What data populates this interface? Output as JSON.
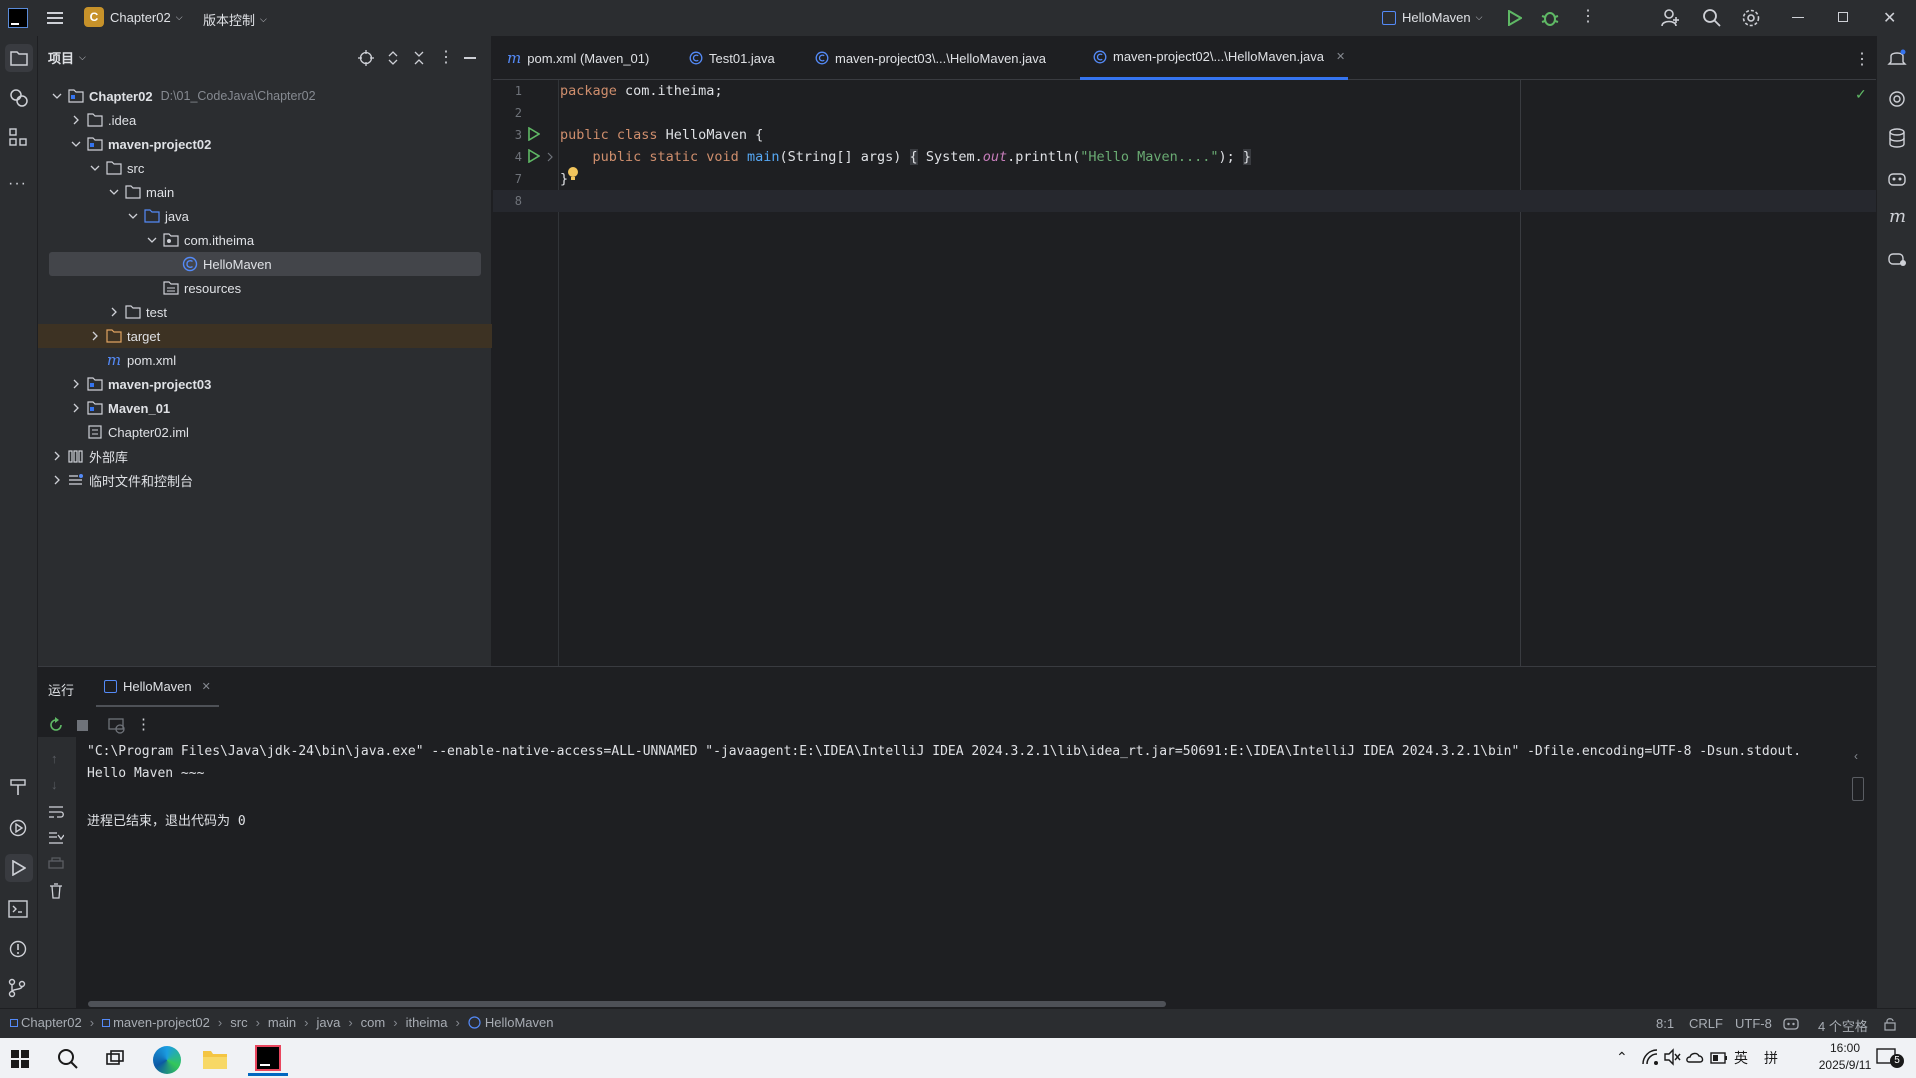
{
  "titlebar": {
    "project_badge": "C",
    "project_name": "Chapter02",
    "vcs_label": "版本控制",
    "run_config": "HelloMaven"
  },
  "project_panel": {
    "title": "项目",
    "tree": [
      {
        "label": "Chapter02",
        "hint": "D:\\01_CodeJava\\Chapter02"
      },
      {
        "label": ".idea"
      },
      {
        "label": "maven-project02"
      },
      {
        "label": "src"
      },
      {
        "label": "main"
      },
      {
        "label": "java"
      },
      {
        "label": "com.itheima"
      },
      {
        "label": "HelloMaven"
      },
      {
        "label": "resources"
      },
      {
        "label": "test"
      },
      {
        "label": "target"
      },
      {
        "label": "pom.xml"
      },
      {
        "label": "maven-project03"
      },
      {
        "label": "Maven_01"
      },
      {
        "label": "Chapter02.iml"
      },
      {
        "label": "外部库"
      },
      {
        "label": "临时文件和控制台"
      }
    ]
  },
  "editor": {
    "tabs": [
      {
        "label": "pom.xml (Maven_01)"
      },
      {
        "label": "Test01.java"
      },
      {
        "label": "maven-project03\\...\\HelloMaven.java"
      },
      {
        "label": "maven-project02\\...\\HelloMaven.java"
      }
    ],
    "line_numbers": [
      "1",
      "2",
      "3",
      "4",
      "7",
      "8"
    ],
    "code": {
      "l1_kw": "package",
      "l1_rest": " com.itheima;",
      "l3_kw": "public class",
      "l3_rest": " HelloMaven {",
      "l4_kw": "public static void",
      "l4_fn": "main",
      "l4_args": "(String[] args)",
      "l4_open": "{",
      "l4_sys": "System.",
      "l4_out": "out",
      "l4_call": ".println(",
      "l4_str": "\"Hello Maven....\"",
      "l4_end": ");",
      "l4_close": "}",
      "l7": "}"
    }
  },
  "run_panel": {
    "title": "运行",
    "tab": "HelloMaven",
    "command": "\"C:\\Program Files\\Java\\jdk-24\\bin\\java.exe\" --enable-native-access=ALL-UNNAMED \"-javaagent:E:\\IDEA\\IntelliJ IDEA 2024.3.2.1\\lib\\idea_rt.jar=50691:E:\\IDEA\\IntelliJ IDEA 2024.3.2.1\\bin\" -Dfile.encoding=UTF-8 -Dsun.stdout.",
    "output": "Hello Maven ~~~",
    "exit": "进程已结束，退出代码为 0"
  },
  "statusbar": {
    "breadcrumbs": [
      "Chapter02",
      "maven-project02",
      "src",
      "main",
      "java",
      "com",
      "itheima",
      "HelloMaven"
    ],
    "position": "8:1",
    "line_ending": "CRLF",
    "encoding": "UTF-8",
    "indent": "4 个空格"
  },
  "taskbar": {
    "ime": "英",
    "ime2": "拼",
    "time": "16:00",
    "date": "2025/9/11",
    "notif_count": "5"
  },
  "colors": {
    "accent": "#3574f0",
    "run_green": "#5fb865",
    "folder_highlight": "#3d3223"
  }
}
